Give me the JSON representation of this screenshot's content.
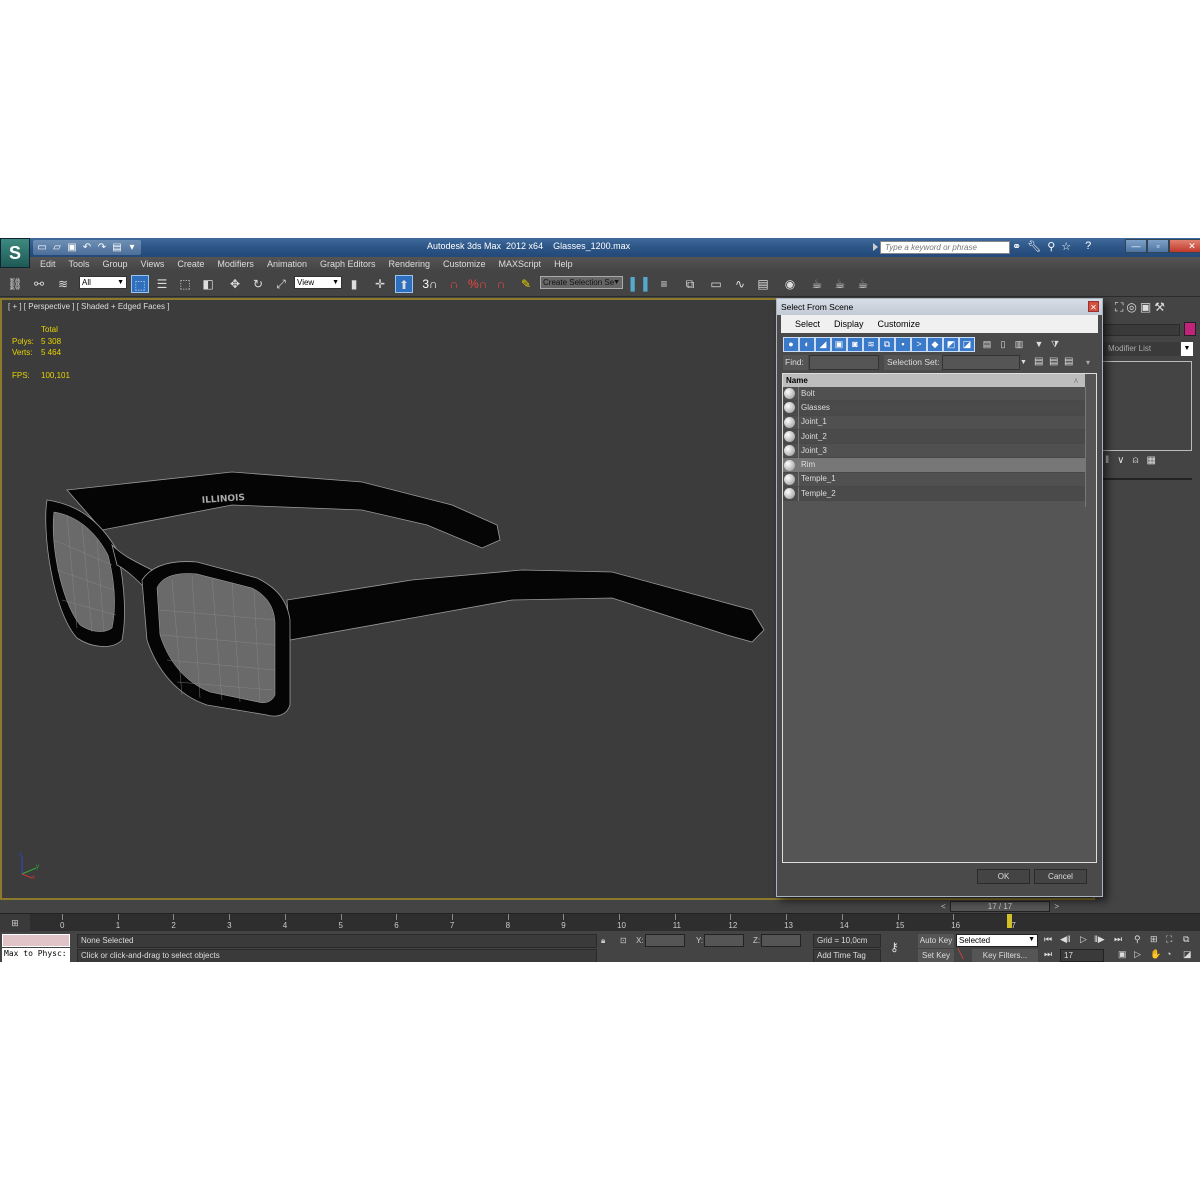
{
  "app": {
    "logo": "3ds-max-logo",
    "window_title": "Autodesk 3ds Max  2012 x64",
    "file_name": "Glasses_1200.max",
    "search_placeholder": "Type a keyword or phrase",
    "quick_access_icons": [
      "new-icon",
      "open-icon",
      "save-icon",
      "undo-icon",
      "redo-icon",
      "project-icon"
    ],
    "title_icons": [
      "binoculars-icon",
      "wrench-icon",
      "satellite-icon",
      "star-icon",
      "help-icon"
    ],
    "window_controls": [
      "minimize",
      "maximize",
      "close"
    ]
  },
  "menubar": {
    "items": [
      "Edit",
      "Tools",
      "Group",
      "Views",
      "Create",
      "Modifiers",
      "Animation",
      "Graph Editors",
      "Rendering",
      "Customize",
      "MAXScript",
      "Help"
    ]
  },
  "toolbar": {
    "selection_filter": "All",
    "reference_coord": "View",
    "named_selection": "Create Selection Se",
    "snap_labels": [
      "3",
      "",
      "%",
      ""
    ]
  },
  "viewport": {
    "label": "[ + ] [ Perspective ] [ Shaded + Edged Faces ]",
    "stats": {
      "header": "Total",
      "rows": [
        {
          "key": "Polys:",
          "value": "5 308"
        },
        {
          "key": "Verts:",
          "value": "5 464"
        }
      ],
      "fps_key": "FPS:",
      "fps_value": "100,101"
    },
    "model_text": "ILLINOIS",
    "axis": {
      "z": "z",
      "y": "y",
      "x": "x"
    }
  },
  "command_panel": {
    "modifier_list": "Modifier List",
    "color_swatch": "#c2237a"
  },
  "dialog": {
    "title": "Select From Scene",
    "menu": [
      "Select",
      "Display",
      "Customize"
    ],
    "find_label": "Find:",
    "find_value": "",
    "selection_set_label": "Selection Set:",
    "selection_set_value": "",
    "column_header": "Name",
    "items": [
      {
        "name": "Bolt",
        "selected": false
      },
      {
        "name": "Glasses",
        "selected": false
      },
      {
        "name": "Joint_1",
        "selected": false
      },
      {
        "name": "Joint_2",
        "selected": false
      },
      {
        "name": "Joint_3",
        "selected": false
      },
      {
        "name": "Rim",
        "selected": true
      },
      {
        "name": "Temple_1",
        "selected": false
      },
      {
        "name": "Temple_2",
        "selected": false
      }
    ],
    "ok_label": "OK",
    "cancel_label": "Cancel"
  },
  "timeline": {
    "frame_display": "17 / 17",
    "ticks": [
      "0",
      "1",
      "2",
      "3",
      "4",
      "5",
      "6",
      "7",
      "8",
      "9",
      "10",
      "11",
      "12",
      "13",
      "14",
      "15",
      "16",
      "17"
    ],
    "current_frame": 17
  },
  "status": {
    "maxscript_text": "Max to Physc:",
    "selection_status": "None Selected",
    "prompt": "Click or click-and-drag to select objects",
    "x_label": "X:",
    "y_label": "Y:",
    "z_label": "Z:",
    "x_value": "",
    "y_value": "",
    "z_value": "",
    "grid": "Grid = 10,0cm",
    "add_time_tag": "Add Time Tag",
    "auto_key": "Auto Key",
    "set_key": "Set Key",
    "key_mode": "Selected",
    "key_filters": "Key Filters...",
    "current_frame": "17"
  }
}
